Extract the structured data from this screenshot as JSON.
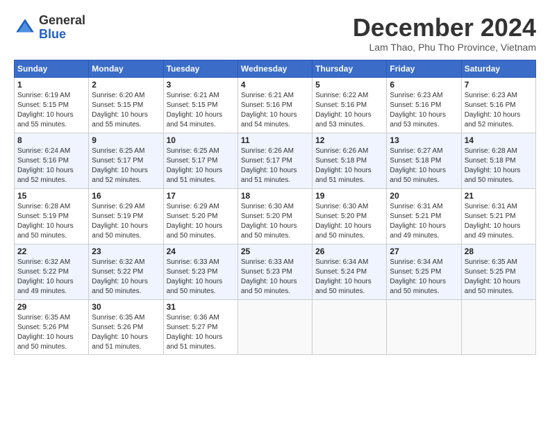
{
  "header": {
    "logo_general": "General",
    "logo_blue": "Blue",
    "month_title": "December 2024",
    "location": "Lam Thao, Phu Tho Province, Vietnam"
  },
  "calendar": {
    "days_of_week": [
      "Sunday",
      "Monday",
      "Tuesday",
      "Wednesday",
      "Thursday",
      "Friday",
      "Saturday"
    ],
    "weeks": [
      [
        {
          "day": "",
          "empty": true
        },
        {
          "day": "",
          "empty": true
        },
        {
          "day": "",
          "empty": true
        },
        {
          "day": "",
          "empty": true
        },
        {
          "day": "",
          "empty": true
        },
        {
          "day": "",
          "empty": true
        },
        {
          "day": "",
          "empty": true
        }
      ]
    ],
    "cells": [
      [
        {
          "num": "1",
          "sunrise": "Sunrise: 6:19 AM",
          "sunset": "Sunset: 5:15 PM",
          "daylight": "Daylight: 10 hours and 55 minutes."
        },
        {
          "num": "2",
          "sunrise": "Sunrise: 6:20 AM",
          "sunset": "Sunset: 5:15 PM",
          "daylight": "Daylight: 10 hours and 55 minutes."
        },
        {
          "num": "3",
          "sunrise": "Sunrise: 6:21 AM",
          "sunset": "Sunset: 5:15 PM",
          "daylight": "Daylight: 10 hours and 54 minutes."
        },
        {
          "num": "4",
          "sunrise": "Sunrise: 6:21 AM",
          "sunset": "Sunset: 5:16 PM",
          "daylight": "Daylight: 10 hours and 54 minutes."
        },
        {
          "num": "5",
          "sunrise": "Sunrise: 6:22 AM",
          "sunset": "Sunset: 5:16 PM",
          "daylight": "Daylight: 10 hours and 53 minutes."
        },
        {
          "num": "6",
          "sunrise": "Sunrise: 6:23 AM",
          "sunset": "Sunset: 5:16 PM",
          "daylight": "Daylight: 10 hours and 53 minutes."
        },
        {
          "num": "7",
          "sunrise": "Sunrise: 6:23 AM",
          "sunset": "Sunset: 5:16 PM",
          "daylight": "Daylight: 10 hours and 52 minutes."
        }
      ],
      [
        {
          "num": "8",
          "sunrise": "Sunrise: 6:24 AM",
          "sunset": "Sunset: 5:16 PM",
          "daylight": "Daylight: 10 hours and 52 minutes."
        },
        {
          "num": "9",
          "sunrise": "Sunrise: 6:25 AM",
          "sunset": "Sunset: 5:17 PM",
          "daylight": "Daylight: 10 hours and 52 minutes."
        },
        {
          "num": "10",
          "sunrise": "Sunrise: 6:25 AM",
          "sunset": "Sunset: 5:17 PM",
          "daylight": "Daylight: 10 hours and 51 minutes."
        },
        {
          "num": "11",
          "sunrise": "Sunrise: 6:26 AM",
          "sunset": "Sunset: 5:17 PM",
          "daylight": "Daylight: 10 hours and 51 minutes."
        },
        {
          "num": "12",
          "sunrise": "Sunrise: 6:26 AM",
          "sunset": "Sunset: 5:18 PM",
          "daylight": "Daylight: 10 hours and 51 minutes."
        },
        {
          "num": "13",
          "sunrise": "Sunrise: 6:27 AM",
          "sunset": "Sunset: 5:18 PM",
          "daylight": "Daylight: 10 hours and 50 minutes."
        },
        {
          "num": "14",
          "sunrise": "Sunrise: 6:28 AM",
          "sunset": "Sunset: 5:18 PM",
          "daylight": "Daylight: 10 hours and 50 minutes."
        }
      ],
      [
        {
          "num": "15",
          "sunrise": "Sunrise: 6:28 AM",
          "sunset": "Sunset: 5:19 PM",
          "daylight": "Daylight: 10 hours and 50 minutes."
        },
        {
          "num": "16",
          "sunrise": "Sunrise: 6:29 AM",
          "sunset": "Sunset: 5:19 PM",
          "daylight": "Daylight: 10 hours and 50 minutes."
        },
        {
          "num": "17",
          "sunrise": "Sunrise: 6:29 AM",
          "sunset": "Sunset: 5:20 PM",
          "daylight": "Daylight: 10 hours and 50 minutes."
        },
        {
          "num": "18",
          "sunrise": "Sunrise: 6:30 AM",
          "sunset": "Sunset: 5:20 PM",
          "daylight": "Daylight: 10 hours and 50 minutes."
        },
        {
          "num": "19",
          "sunrise": "Sunrise: 6:30 AM",
          "sunset": "Sunset: 5:20 PM",
          "daylight": "Daylight: 10 hours and 50 minutes."
        },
        {
          "num": "20",
          "sunrise": "Sunrise: 6:31 AM",
          "sunset": "Sunset: 5:21 PM",
          "daylight": "Daylight: 10 hours and 49 minutes."
        },
        {
          "num": "21",
          "sunrise": "Sunrise: 6:31 AM",
          "sunset": "Sunset: 5:21 PM",
          "daylight": "Daylight: 10 hours and 49 minutes."
        }
      ],
      [
        {
          "num": "22",
          "sunrise": "Sunrise: 6:32 AM",
          "sunset": "Sunset: 5:22 PM",
          "daylight": "Daylight: 10 hours and 49 minutes."
        },
        {
          "num": "23",
          "sunrise": "Sunrise: 6:32 AM",
          "sunset": "Sunset: 5:22 PM",
          "daylight": "Daylight: 10 hours and 50 minutes."
        },
        {
          "num": "24",
          "sunrise": "Sunrise: 6:33 AM",
          "sunset": "Sunset: 5:23 PM",
          "daylight": "Daylight: 10 hours and 50 minutes."
        },
        {
          "num": "25",
          "sunrise": "Sunrise: 6:33 AM",
          "sunset": "Sunset: 5:23 PM",
          "daylight": "Daylight: 10 hours and 50 minutes."
        },
        {
          "num": "26",
          "sunrise": "Sunrise: 6:34 AM",
          "sunset": "Sunset: 5:24 PM",
          "daylight": "Daylight: 10 hours and 50 minutes."
        },
        {
          "num": "27",
          "sunrise": "Sunrise: 6:34 AM",
          "sunset": "Sunset: 5:25 PM",
          "daylight": "Daylight: 10 hours and 50 minutes."
        },
        {
          "num": "28",
          "sunrise": "Sunrise: 6:35 AM",
          "sunset": "Sunset: 5:25 PM",
          "daylight": "Daylight: 10 hours and 50 minutes."
        }
      ],
      [
        {
          "num": "29",
          "sunrise": "Sunrise: 6:35 AM",
          "sunset": "Sunset: 5:26 PM",
          "daylight": "Daylight: 10 hours and 50 minutes."
        },
        {
          "num": "30",
          "sunrise": "Sunrise: 6:35 AM",
          "sunset": "Sunset: 5:26 PM",
          "daylight": "Daylight: 10 hours and 51 minutes."
        },
        {
          "num": "31",
          "sunrise": "Sunrise: 6:36 AM",
          "sunset": "Sunset: 5:27 PM",
          "daylight": "Daylight: 10 hours and 51 minutes."
        },
        {
          "num": "",
          "empty": true
        },
        {
          "num": "",
          "empty": true
        },
        {
          "num": "",
          "empty": true
        },
        {
          "num": "",
          "empty": true
        }
      ]
    ]
  }
}
